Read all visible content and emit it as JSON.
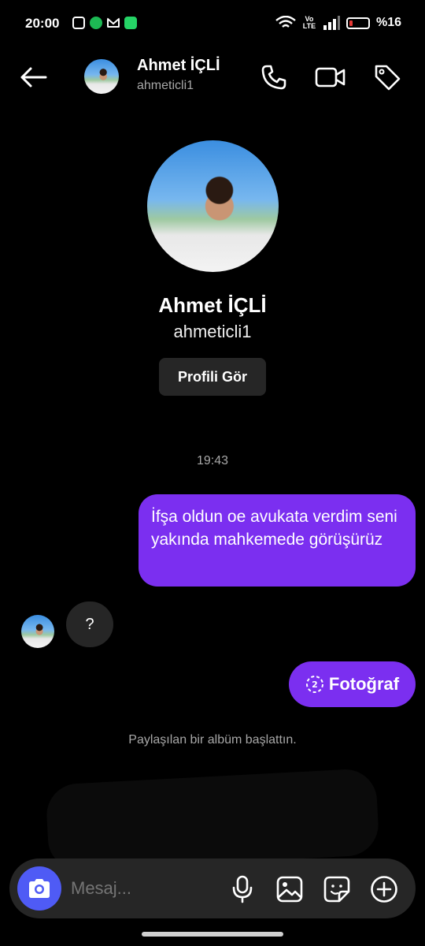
{
  "status_bar": {
    "time": "20:00",
    "battery": "%16",
    "network_label": "Vo LTE"
  },
  "header": {
    "name": "Ahmet İÇLİ",
    "username": "ahmeticli1"
  },
  "profile": {
    "name": "Ahmet İÇLİ",
    "username": "ahmeticli1",
    "view_profile_label": "Profili Gör"
  },
  "chat": {
    "timestamp": "19:43",
    "messages": [
      {
        "direction": "outgoing",
        "text": "İfşa oldun oe avukata verdim seni yakında mahkemede görüşürüz"
      },
      {
        "direction": "incoming",
        "text": "?"
      },
      {
        "direction": "outgoing",
        "text": "Fotoğraf"
      }
    ],
    "system_message": "Paylaşılan bir albüm başlattın."
  },
  "composer": {
    "placeholder": "Mesaj..."
  },
  "colors": {
    "background": "#000000",
    "outgoing_bubble": "#7b2ff0",
    "incoming_bubble": "#262626",
    "camera_button": "#4f5bf5"
  }
}
